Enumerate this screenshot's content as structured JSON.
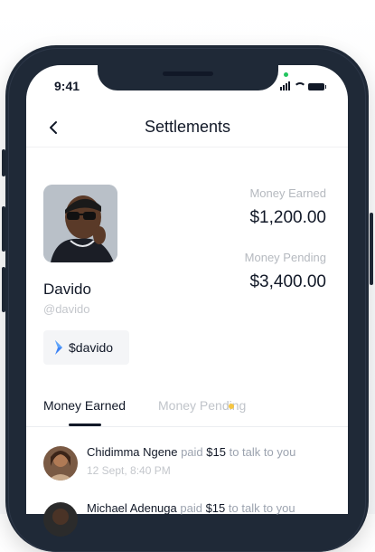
{
  "status_bar": {
    "time": "9:41"
  },
  "header": {
    "title": "Settlements"
  },
  "profile": {
    "name": "Davido",
    "handle": "@davido",
    "tag": "$davido"
  },
  "stats": {
    "earned_label": "Money Earned",
    "earned_value": "$1,200.00",
    "pending_label": "Money Pending",
    "pending_value": "$3,400.00"
  },
  "tabs": [
    {
      "label": "Money Earned",
      "active": true
    },
    {
      "label": "Money Pending",
      "active": false,
      "indicator_color": "#f5c542"
    }
  ],
  "activity": [
    {
      "name": "Chidimma Ngene",
      "paid_word": "paid",
      "amount": "$15",
      "suffix": "to talk to you",
      "time": "12 Sept, 8:40 PM"
    },
    {
      "name": "Michael Adenuga",
      "paid_word": "paid",
      "amount": "$15",
      "suffix": "to talk to you",
      "time": ""
    }
  ],
  "icons": {
    "back": "chevron-left-icon",
    "tag_logo": "brand-logo-icon",
    "signal": "signal-icon",
    "wifi": "wifi-icon",
    "battery": "battery-icon"
  }
}
